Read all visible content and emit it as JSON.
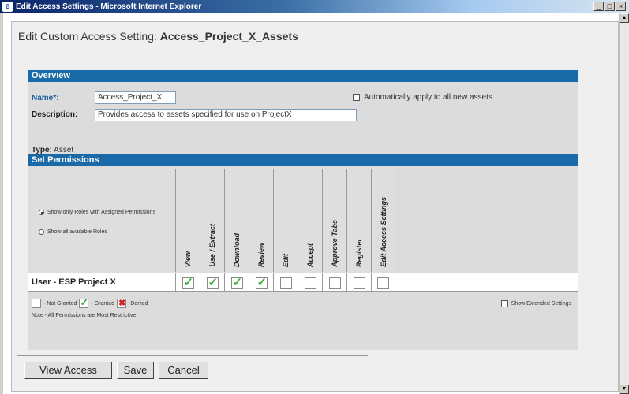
{
  "window": {
    "title": "Edit Access Settings - Microsoft Internet Explorer",
    "buttons": [
      "_",
      "□",
      "×"
    ]
  },
  "page": {
    "title_prefix": "Edit Custom Access Setting: ",
    "title_name": "Access_Project_X_Assets"
  },
  "overview": {
    "header": "Overview",
    "name_label": "Name*:",
    "name_value": "Access_Project_X",
    "auto_apply_label": "Automatically apply to all new assets",
    "auto_apply_checked": false,
    "description_label": "Description:",
    "description_value": "Provides access to assets specified for use on ProjectX",
    "type_label": "Type:",
    "type_value": "Asset"
  },
  "permissions": {
    "header": "Set Permissions",
    "radio_options": [
      {
        "label": "Show only Roles with Assigned Permissions",
        "checked": true
      },
      {
        "label": "Show all available Roles",
        "checked": false
      }
    ],
    "columns": [
      "View",
      "Use / Extract",
      "Download",
      "Review",
      "Edit",
      "Accept",
      "Approve Tabs",
      "Register",
      "Edit Access Settings"
    ],
    "rows": [
      {
        "role": "User - ESP Project X",
        "granted": [
          true,
          true,
          true,
          true,
          false,
          false,
          false,
          false,
          false
        ]
      }
    ],
    "legend": {
      "not_granted": "- Not Granted",
      "granted": "- Granted",
      "denied": "-Denied"
    },
    "note": "Note - All Permissions are Most Restrictive",
    "show_extended_label": "Show Extended Settings"
  },
  "actions": {
    "view_access": "View Access",
    "save": "Save",
    "cancel": "Cancel"
  }
}
